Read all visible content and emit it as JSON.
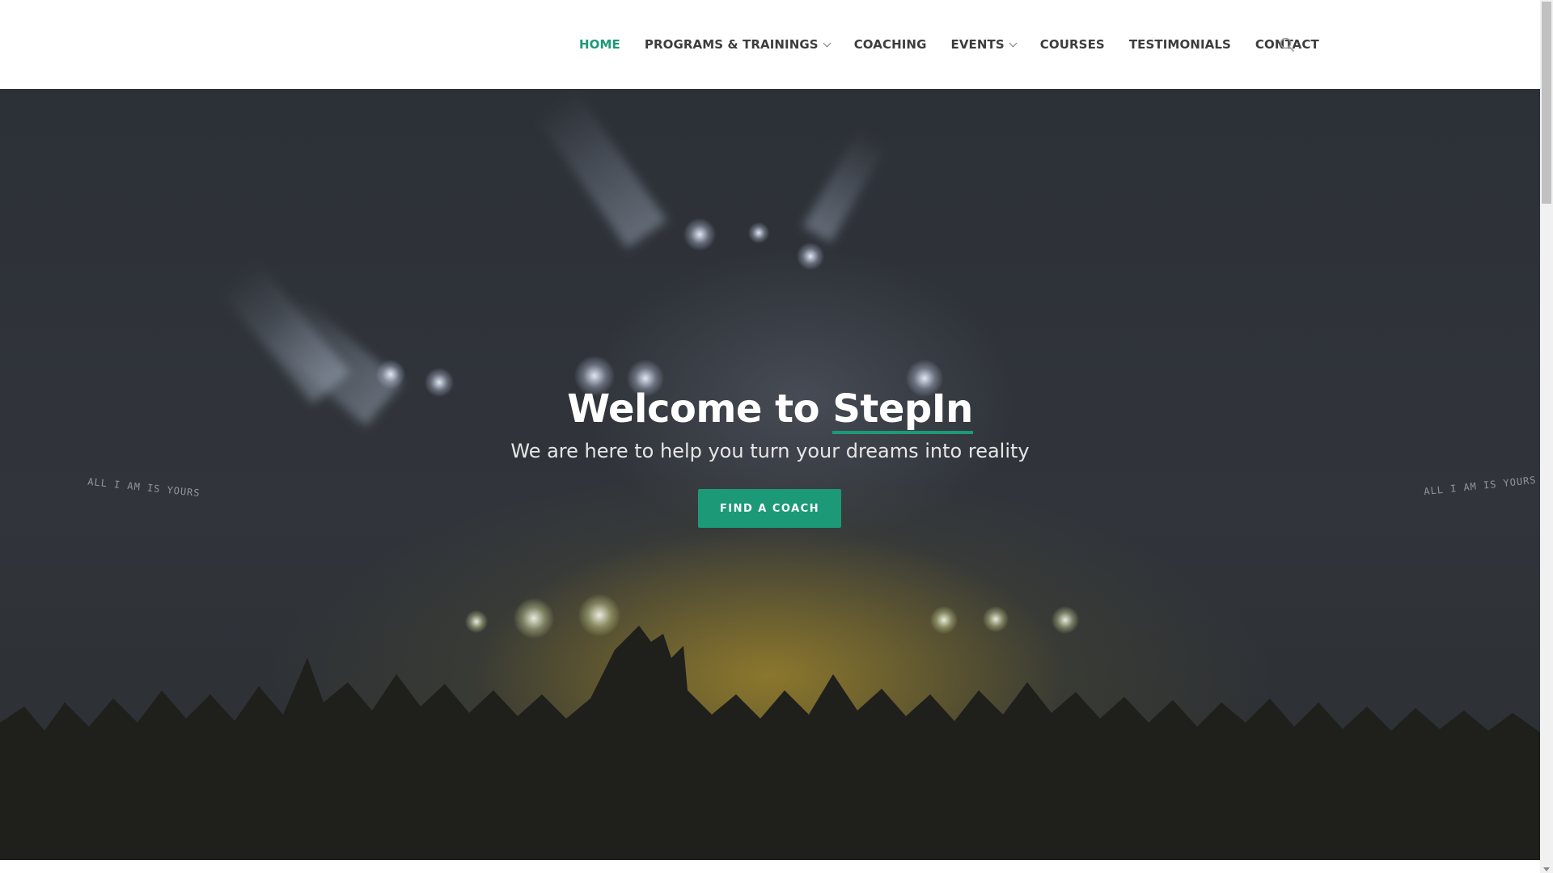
{
  "nav": {
    "items": [
      {
        "label": "HOME",
        "active": true,
        "dropdown": false
      },
      {
        "label": "PROGRAMS & TRAININGS",
        "active": false,
        "dropdown": true
      },
      {
        "label": "COACHING",
        "active": false,
        "dropdown": false
      },
      {
        "label": "EVENTS",
        "active": false,
        "dropdown": true
      },
      {
        "label": "COURSES",
        "active": false,
        "dropdown": false
      },
      {
        "label": "TESTIMONIALS",
        "active": false,
        "dropdown": false
      },
      {
        "label": "CONTACT",
        "active": false,
        "dropdown": false
      }
    ],
    "search_icon": "search-icon"
  },
  "hero": {
    "title_prefix": "Welcome to ",
    "title_brand": "StepIn",
    "subtitle": "We are here to help you turn your dreams into reality",
    "cta_label": "FIND A COACH",
    "screen_text_left": "ALL I AM IS YOURS",
    "screen_text_right": "ALL I AM IS YOURS"
  },
  "colors": {
    "accent": "#1c9a77",
    "nav_text": "#3d3d3d",
    "hero_overlay": "#2e3238"
  }
}
